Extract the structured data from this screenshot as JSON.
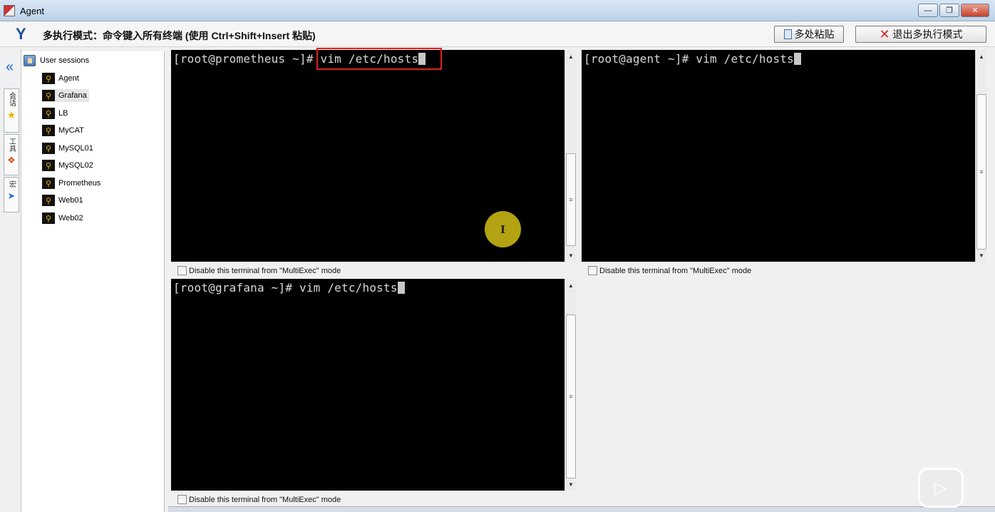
{
  "window": {
    "title": "Agent"
  },
  "multiexec": {
    "mode_text": "多执行模式：命令键入所有终端 (使用 Ctrl+Shift+Insert 粘贴)",
    "paste_button": "多处粘贴",
    "exit_button": "退出多执行模式"
  },
  "sidebar_tabs": [
    {
      "label": "会话",
      "icon": "star-icon"
    },
    {
      "label": "工具",
      "icon": "tools-icon"
    },
    {
      "label": "宏",
      "icon": "send-icon"
    }
  ],
  "tree": {
    "root": "User sessions",
    "items": [
      {
        "label": "Agent",
        "selected": false
      },
      {
        "label": "Grafana",
        "selected": true
      },
      {
        "label": "LB",
        "selected": false
      },
      {
        "label": "MyCAT",
        "selected": false
      },
      {
        "label": "MySQL01",
        "selected": false
      },
      {
        "label": "MySQL02",
        "selected": false
      },
      {
        "label": "Prometheus",
        "selected": false
      },
      {
        "label": "Web01",
        "selected": false
      },
      {
        "label": "Web02",
        "selected": false
      }
    ]
  },
  "terminals": [
    {
      "prompt": "[root@prometheus ~]# ",
      "command": "vim /etc/hosts",
      "disable_label": "Disable this terminal from \"MultiExec\" mode"
    },
    {
      "prompt": "[root@agent ~]# ",
      "command": "vim /etc/hosts",
      "disable_label": "Disable this terminal from \"MultiExec\" mode"
    },
    {
      "prompt": "[root@grafana ~]# ",
      "command": "vim /etc/hosts",
      "disable_label": "Disable this terminal from \"MultiExec\" mode"
    }
  ],
  "pointer_glyph": "I",
  "colors": {
    "highlight": "#e02020",
    "pointer": "#d2be14",
    "accent": "#1a6bd0"
  }
}
